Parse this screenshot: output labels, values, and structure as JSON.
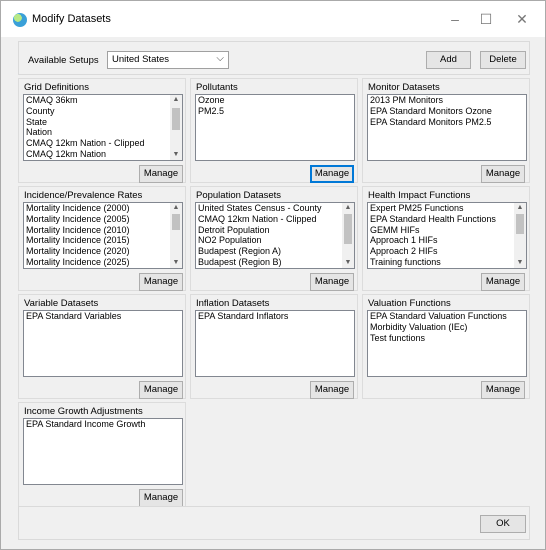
{
  "window": {
    "title": "Modify Datasets",
    "icon": "app-globe-icon",
    "controls": {
      "minimize": "–",
      "maximize": "☐",
      "close": "✕"
    }
  },
  "setups": {
    "label": "Available Setups",
    "selected": "United States",
    "add_label": "Add",
    "delete_label": "Delete"
  },
  "groups": {
    "grid": {
      "title": "Grid Definitions",
      "items": [
        "CMAQ 36km",
        "County",
        "State",
        "Nation",
        "CMAQ 12km Nation - Clipped",
        "CMAQ 12km Nation"
      ],
      "manage_label": "Manage"
    },
    "pollutants": {
      "title": "Pollutants",
      "items": [
        "Ozone",
        "PM2.5"
      ],
      "manage_label": "Manage"
    },
    "monitor": {
      "title": "Monitor Datasets",
      "items": [
        "2013 PM Monitors",
        "EPA Standard Monitors Ozone",
        "EPA Standard Monitors PM2.5"
      ],
      "manage_label": "Manage"
    },
    "incidence": {
      "title": "Incidence/Prevalence Rates",
      "items": [
        "Mortality Incidence (2000)",
        "Mortality Incidence (2005)",
        "Mortality Incidence (2010)",
        "Mortality Incidence (2015)",
        "Mortality Incidence (2020)",
        "Mortality Incidence (2025)"
      ],
      "manage_label": "Manage"
    },
    "population": {
      "title": "Population Datasets",
      "items": [
        "United States Census - County",
        "CMAQ 12km Nation - Clipped",
        "Detroit Population",
        "NO2 Population",
        "Budapest (Region A)",
        "Budapest (Region B)"
      ],
      "manage_label": "Manage"
    },
    "health": {
      "title": "Health Impact Functions",
      "items": [
        "Expert PM25 Functions",
        "EPA Standard Health Functions",
        "GEMM HIFs",
        "Approach 1 HIFs",
        "Approach 2 HIFs",
        "Training functions"
      ],
      "manage_label": "Manage"
    },
    "variable": {
      "title": "Variable Datasets",
      "items": [
        "EPA Standard Variables"
      ],
      "manage_label": "Manage"
    },
    "inflation": {
      "title": "Inflation Datasets",
      "items": [
        "EPA Standard Inflators"
      ],
      "manage_label": "Manage"
    },
    "valuation": {
      "title": "Valuation Functions",
      "items": [
        "EPA Standard Valuation Functions",
        "Morbidity Valuation (IEc)",
        "Test functions"
      ],
      "manage_label": "Manage"
    },
    "income": {
      "title": "Income Growth Adjustments",
      "items": [
        "EPA Standard Income Growth"
      ],
      "manage_label": "Manage"
    }
  },
  "footer": {
    "ok_label": "OK"
  }
}
